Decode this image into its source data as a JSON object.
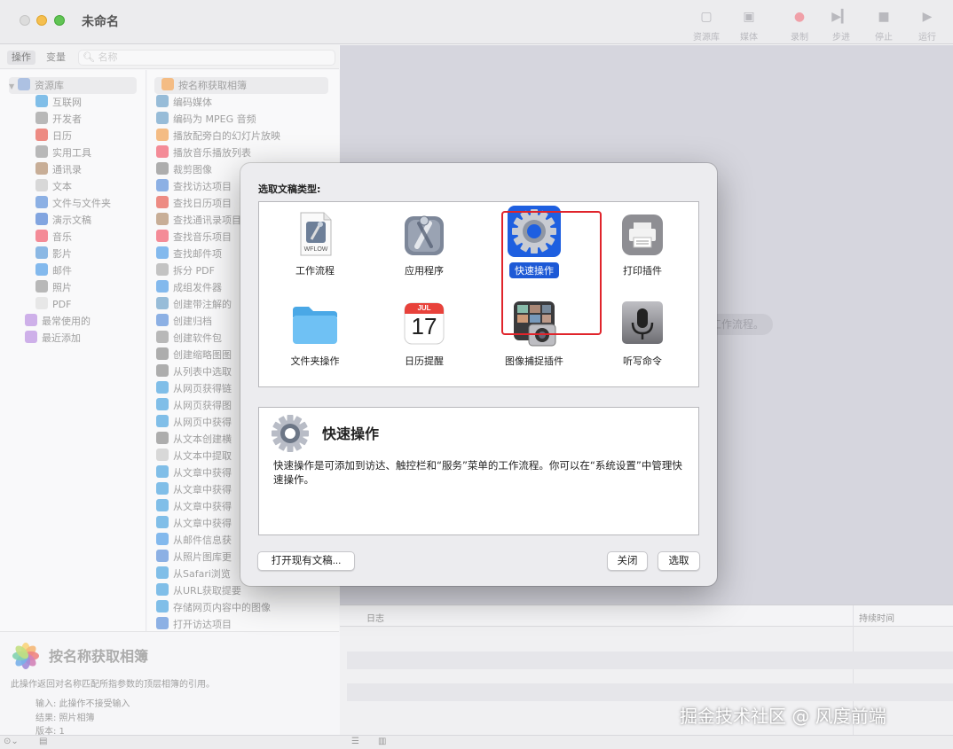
{
  "window": {
    "title": "未命名"
  },
  "toolbar": [
    {
      "label": "资源库",
      "icon": "library-icon",
      "glyph": "▢"
    },
    {
      "label": "媒体",
      "icon": "media-icon",
      "glyph": "▣"
    },
    {
      "label": "录制",
      "icon": "record-icon",
      "glyph": "●"
    },
    {
      "label": "步进",
      "icon": "step-icon",
      "glyph": "▶▎"
    },
    {
      "label": "停止",
      "icon": "stop-icon",
      "glyph": "■"
    },
    {
      "label": "运行",
      "icon": "run-icon",
      "glyph": "▶"
    }
  ],
  "library": {
    "tabs": [
      "操作",
      "变量"
    ],
    "search_placeholder": "名称",
    "categories": [
      {
        "label": "资源库",
        "color": "#8aa6d6",
        "selected": true
      },
      {
        "label": "互联网",
        "color": "#4aa3df"
      },
      {
        "label": "开发者",
        "color": "#9a9a9a"
      },
      {
        "label": "日历",
        "color": "#e55a4e"
      },
      {
        "label": "实用工具",
        "color": "#9a9a9a"
      },
      {
        "label": "通讯录",
        "color": "#b08c6a"
      },
      {
        "label": "文本",
        "color": "#c8c8c8"
      },
      {
        "label": "文件与文件夹",
        "color": "#5b8fd8"
      },
      {
        "label": "演示文稿",
        "color": "#4d7fd3"
      },
      {
        "label": "音乐",
        "color": "#f05a6a"
      },
      {
        "label": "影片",
        "color": "#5a9ad8"
      },
      {
        "label": "邮件",
        "color": "#4e9be6"
      },
      {
        "label": "照片",
        "color": "#9a9a9a"
      },
      {
        "label": "PDF",
        "color": "#dddddd"
      },
      {
        "label": "最常使用的",
        "color": "#b98fe0"
      },
      {
        "label": "最近添加",
        "color": "#b98fe0"
      }
    ],
    "actions": [
      {
        "label": "按名称获取相簿",
        "color": "#f0a050",
        "selected": true
      },
      {
        "label": "编码媒体",
        "color": "#6aa0c8"
      },
      {
        "label": "编码为 MPEG 音频",
        "color": "#6aa0c8"
      },
      {
        "label": "播放配旁白的幻灯片放映",
        "color": "#f0a050"
      },
      {
        "label": "播放音乐播放列表",
        "color": "#f05a6a"
      },
      {
        "label": "裁剪图像",
        "color": "#8a8a8a"
      },
      {
        "label": "查找访达项目",
        "color": "#5b8fd8"
      },
      {
        "label": "查找日历项目",
        "color": "#e55a4e"
      },
      {
        "label": "查找通讯录项目",
        "color": "#b08c6a"
      },
      {
        "label": "查找音乐项目",
        "color": "#f05a6a"
      },
      {
        "label": "查找邮件项",
        "color": "#4e9be6"
      },
      {
        "label": "拆分 PDF",
        "color": "#aaaaaa"
      },
      {
        "label": "成组发件器",
        "color": "#4e9be6"
      },
      {
        "label": "创建带注解的",
        "color": "#6aa0c8"
      },
      {
        "label": "创建归档",
        "color": "#5b8fd8"
      },
      {
        "label": "创建软件包",
        "color": "#9a9a9a"
      },
      {
        "label": "创建缩略图图",
        "color": "#8a8a8a"
      },
      {
        "label": "从列表中选取",
        "color": "#8a8a8a"
      },
      {
        "label": "从网页获得链",
        "color": "#4aa3df"
      },
      {
        "label": "从网页获得图",
        "color": "#4aa3df"
      },
      {
        "label": "从网页中获得",
        "color": "#4aa3df"
      },
      {
        "label": "从文本创建横",
        "color": "#8a8a8a"
      },
      {
        "label": "从文本中提取",
        "color": "#c8c8c8"
      },
      {
        "label": "从文章中获得",
        "color": "#4aa3df"
      },
      {
        "label": "从文章中获得",
        "color": "#4aa3df"
      },
      {
        "label": "从文章中获得",
        "color": "#4aa3df"
      },
      {
        "label": "从文章中获得",
        "color": "#4aa3df"
      },
      {
        "label": "从邮件信息获",
        "color": "#4e9be6"
      },
      {
        "label": "从照片图库更",
        "color": "#5b8fd8"
      },
      {
        "label": "从Safari浏览",
        "color": "#4aa3df"
      },
      {
        "label": "从URL获取提要",
        "color": "#4aa3df"
      },
      {
        "label": "存储网页内容中的图像",
        "color": "#4aa3df"
      },
      {
        "label": "打开访达项目",
        "color": "#5b8fd8"
      }
    ],
    "description": {
      "title": "按名称获取相簿",
      "text": "此操作返回对名称匹配所指参数的顶层相簿的引用。",
      "input": "输入: 此操作不接受输入",
      "result": "结果: 照片相簿",
      "version": "版本: 1"
    }
  },
  "workflow": {
    "hint": "工作流程。"
  },
  "log": {
    "col_log": "日志",
    "col_duration": "持续时间"
  },
  "dialog": {
    "label": "选取文稿类型:",
    "types": [
      {
        "label": "工作流程",
        "icon": "workflow-icon",
        "selected": false
      },
      {
        "label": "应用程序",
        "icon": "application-icon",
        "selected": false
      },
      {
        "label": "快速操作",
        "icon": "quick-action-gear-icon",
        "selected": true
      },
      {
        "label": "打印插件",
        "icon": "print-plugin-icon",
        "selected": false
      },
      {
        "label": "文件夹操作",
        "icon": "folder-icon",
        "selected": false
      },
      {
        "label": "日历提醒",
        "icon": "calendar-icon",
        "selected": false
      },
      {
        "label": "图像捕捉插件",
        "icon": "image-capture-icon",
        "selected": false
      },
      {
        "label": "听写命令",
        "icon": "microphone-icon",
        "selected": false
      }
    ],
    "workflow_badge": "WFLOW",
    "calendar_month": "JUL",
    "calendar_day": "17",
    "info_title": "快速操作",
    "info_text": "快速操作是可添加到访达、触控栏和“服务”菜单的工作流程。你可以在“系统设置”中管理快速操作。",
    "open_button": "打开现有文稿...",
    "close_button": "关闭",
    "choose_button": "选取"
  },
  "watermark": "掘金技术社区 @ 风度前端"
}
